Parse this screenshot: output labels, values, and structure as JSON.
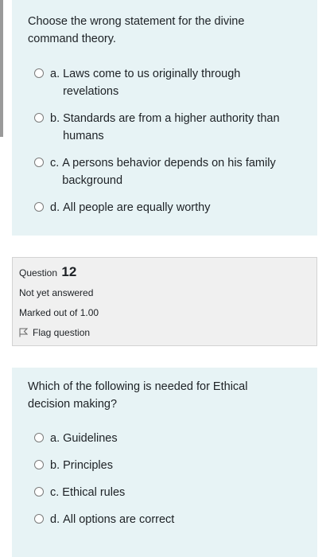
{
  "question_prev": {
    "text": "Choose the wrong statement for the divine command theory.",
    "options": [
      {
        "letter": "a.",
        "text": "Laws come to us originally through revelations"
      },
      {
        "letter": "b.",
        "text": "Standards are from a higher authority than humans"
      },
      {
        "letter": "c.",
        "text": "A persons behavior depends on his family background"
      },
      {
        "letter": "d.",
        "text": "All people are equally worthy"
      }
    ]
  },
  "question_info": {
    "label": "Question",
    "number": "12",
    "status": "Not yet answered",
    "marks": "Marked out of 1.00",
    "flag_label": "Flag question"
  },
  "question_current": {
    "text": "Which of the following is needed for Ethical decision making?",
    "options": [
      {
        "letter": "a.",
        "text": "Guidelines"
      },
      {
        "letter": "b.",
        "text": "Principles"
      },
      {
        "letter": "c.",
        "text": "Ethical rules"
      },
      {
        "letter": "d.",
        "text": "All options are correct"
      }
    ]
  }
}
